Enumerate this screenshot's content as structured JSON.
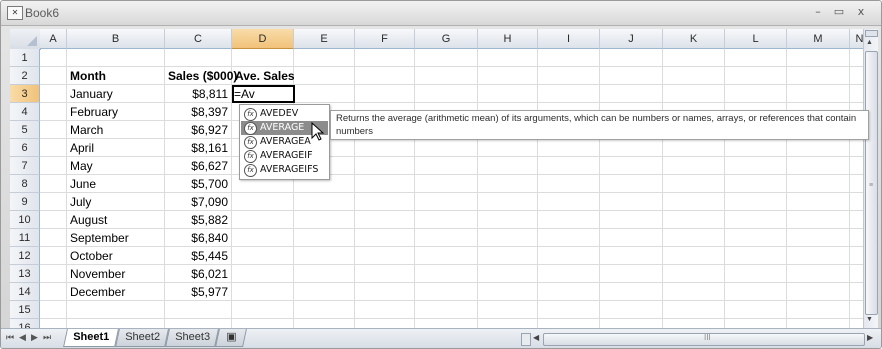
{
  "window": {
    "title": "Book6",
    "icon": "excel-doc-icon",
    "min": "–",
    "max": "▭",
    "close": "x"
  },
  "columns": [
    "A",
    "B",
    "C",
    "D",
    "E",
    "F",
    "G",
    "H",
    "I",
    "J",
    "K",
    "L",
    "M",
    "N"
  ],
  "rows": [
    "1",
    "2",
    "3",
    "4",
    "5",
    "6",
    "7",
    "8",
    "9",
    "10",
    "11",
    "12",
    "13",
    "14",
    "15",
    "16"
  ],
  "headers": {
    "month": "Month",
    "sales": "Sales ($000)",
    "ave": "Ave. Sales"
  },
  "data": [
    {
      "month": "January",
      "sales": "$8,811"
    },
    {
      "month": "February",
      "sales": "$8,397"
    },
    {
      "month": "March",
      "sales": "$6,927"
    },
    {
      "month": "April",
      "sales": "$8,161"
    },
    {
      "month": "May",
      "sales": "$6,627"
    },
    {
      "month": "June",
      "sales": "$5,700"
    },
    {
      "month": "July",
      "sales": "$7,090"
    },
    {
      "month": "August",
      "sales": "$5,882"
    },
    {
      "month": "September",
      "sales": "$6,840"
    },
    {
      "month": "October",
      "sales": "$5,445"
    },
    {
      "month": "November",
      "sales": "$6,021"
    },
    {
      "month": "December",
      "sales": "$5,977"
    }
  ],
  "formula": "=Av",
  "autocomplete": {
    "items": [
      "AVEDEV",
      "AVERAGE",
      "AVERAGEA",
      "AVERAGEIF",
      "AVERAGEIFS"
    ],
    "selected": "AVERAGE",
    "fx_glyph": "fx"
  },
  "tooltip": "Returns the average (arithmetic mean) of its arguments, which can be numbers or names, arrays, or references that contain numbers",
  "sheets": [
    "Sheet1",
    "Sheet2",
    "Sheet3"
  ],
  "active_sheet": "Sheet1",
  "nav_glyphs": {
    "first": "⏮",
    "prev": "◀",
    "next": "▶",
    "last": "⏭"
  },
  "scroll_grip": "III",
  "colors": {
    "header_selected": "#f1c27a",
    "autocomplete_highlight": "#8c8c8c"
  }
}
